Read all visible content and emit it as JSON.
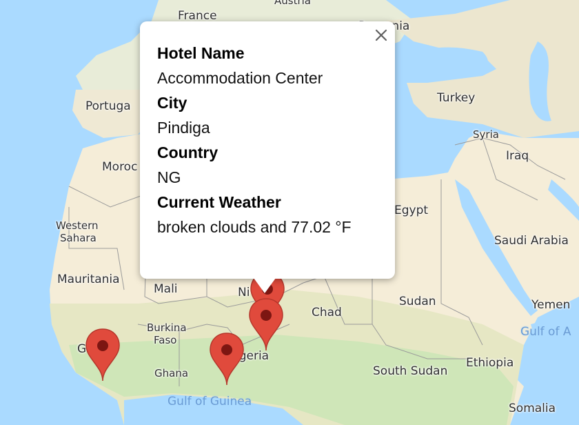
{
  "map": {
    "labels": {
      "france": "France",
      "austria": "Austria",
      "romania": "Romania",
      "portugal": "Portuga",
      "turkey": "Turkey",
      "syria": "Syria",
      "morocco": "Moroc",
      "iraq": "Iraq",
      "western_sahara_1": "Western",
      "western_sahara_2": "Sahara",
      "egypt": "Egypt",
      "saudi_arabia": "Saudi Arabia",
      "mauritania": "Mauritania",
      "mali": "Mali",
      "niger": "Ni",
      "sudan": "Sudan",
      "yemen": "Yemen",
      "chad": "Chad",
      "burkina_1": "Burkina",
      "burkina_2": "Faso",
      "gulf_of_aden": "Gulf of A",
      "guinea_partial": "G",
      "nigeria": "igeria",
      "ethiopia": "Ethiopia",
      "ghana": "Ghana",
      "south_sudan": "South Sudan",
      "gulf_of_guinea": "Gulf of Guinea",
      "somalia": "Somalia"
    },
    "colors": {
      "water": "#aadaff",
      "land": "#f3efe2",
      "desert": "#f5edd8",
      "green": "#cfe6b8",
      "marker": "#e04a3c",
      "marker_dot": "#7d1612"
    }
  },
  "info_window": {
    "fields": [
      {
        "label": "Hotel Name",
        "value": "Accommodation Center"
      },
      {
        "label": "City",
        "value": "Pindiga"
      },
      {
        "label": "Country",
        "value": "NG"
      },
      {
        "label": "Current Weather",
        "value": "broken clouds and 77.02 °F"
      }
    ]
  }
}
